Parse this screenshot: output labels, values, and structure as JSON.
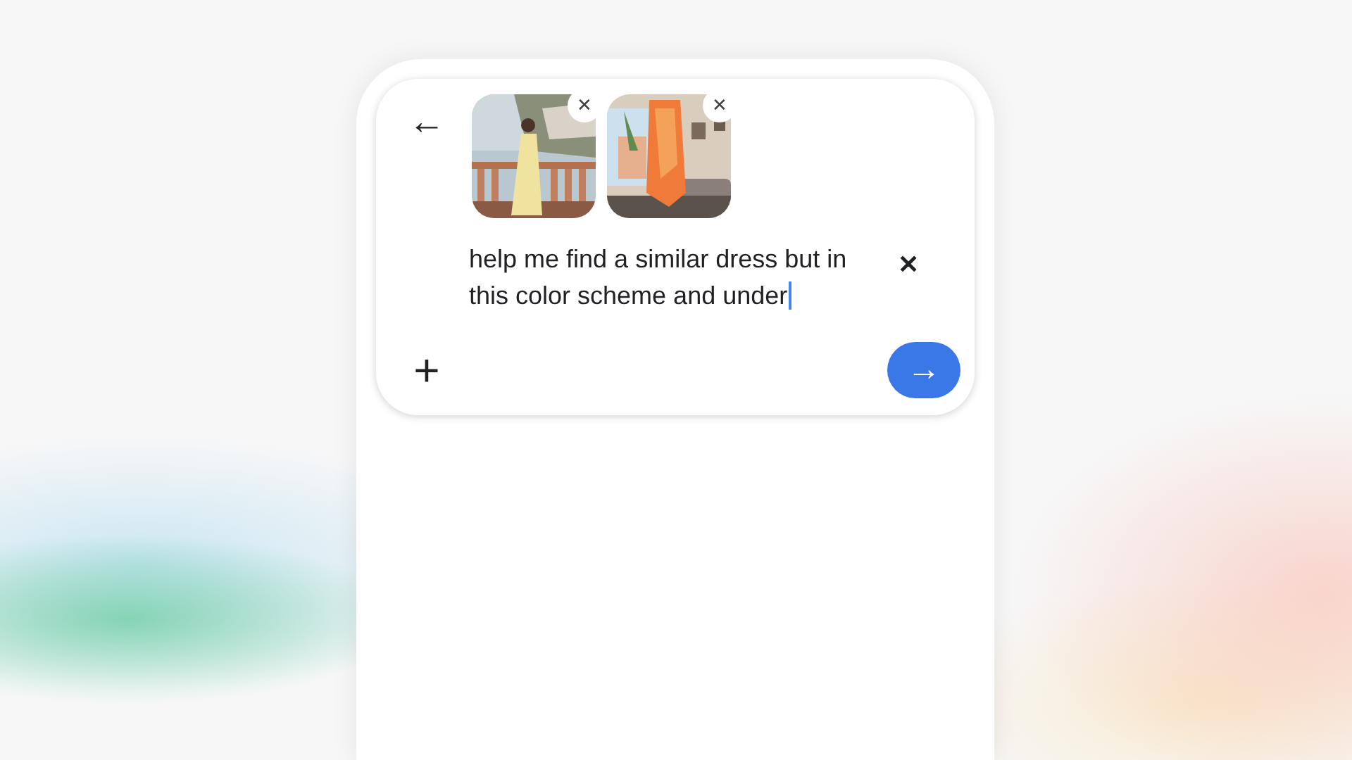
{
  "attachments": [
    {
      "kind": "picture",
      "remove_label": "✕"
    },
    {
      "kind": "picture",
      "remove_label": "✕"
    }
  ],
  "query": {
    "value": "help me find a similar dress but in this color scheme and under",
    "focused": true,
    "clear_label": "✕"
  },
  "buttons": {
    "back": "←",
    "add": "+",
    "send": "→"
  }
}
